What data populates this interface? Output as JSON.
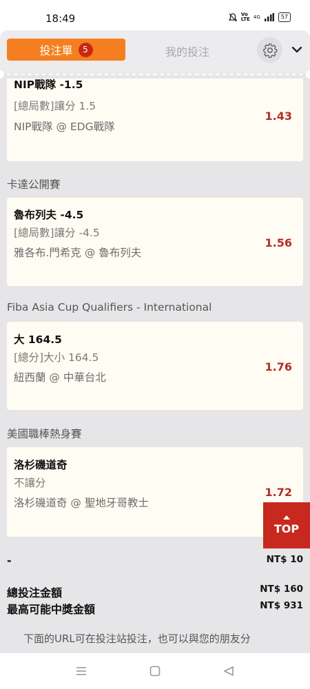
{
  "status": {
    "time": "18:49",
    "battery": "57",
    "signal": "4G",
    "volte": "Vo LTE"
  },
  "header": {
    "tab_active_label": "投注單",
    "tab_active_count": "5",
    "tab_inactive_label": "我的投注",
    "settings_icon": "gear-icon",
    "collapse_icon": "chevron-down-icon"
  },
  "bets": [
    {
      "league": "",
      "selection": "NIP戰隊 -1.5",
      "market": "[總局數]讓分 1.5",
      "match": "NIP戰隊 @ EDG戰隊",
      "odds": "1.43"
    },
    {
      "league": "卡達公開賽",
      "selection": "魯布列夫 -4.5",
      "market": "[總局數]讓分 -4.5",
      "match": "雅各布.門希克 @ 魯布列夫",
      "odds": "1.56"
    },
    {
      "league": "Fiba Asia Cup Qualifiers - International",
      "selection": "大 164.5",
      "market": "[總分]大小 164.5",
      "match": "紐西蘭 @ 中華台北",
      "odds": "1.76"
    },
    {
      "league": "美國職棒熱身賽",
      "selection": "洛杉磯道奇",
      "market": "不讓分",
      "match": "洛杉磯道奇 @ 聖地牙哥教士",
      "odds": "1.72"
    }
  ],
  "top_button": "TOP",
  "summary": {
    "stake_label": "-",
    "stake_value": "NT$ 10",
    "total_label": "總投注金額",
    "total_value": "NT$ 160",
    "max_win_label": "最高可能中獎金額",
    "max_win_value": "NT$ 931"
  },
  "footer_text": "下面的URL可在投注站投注，也可以與您的朋友分",
  "nav": {
    "menu_icon": "menu-icon",
    "home_icon": "home-icon",
    "back_icon": "back-icon"
  }
}
